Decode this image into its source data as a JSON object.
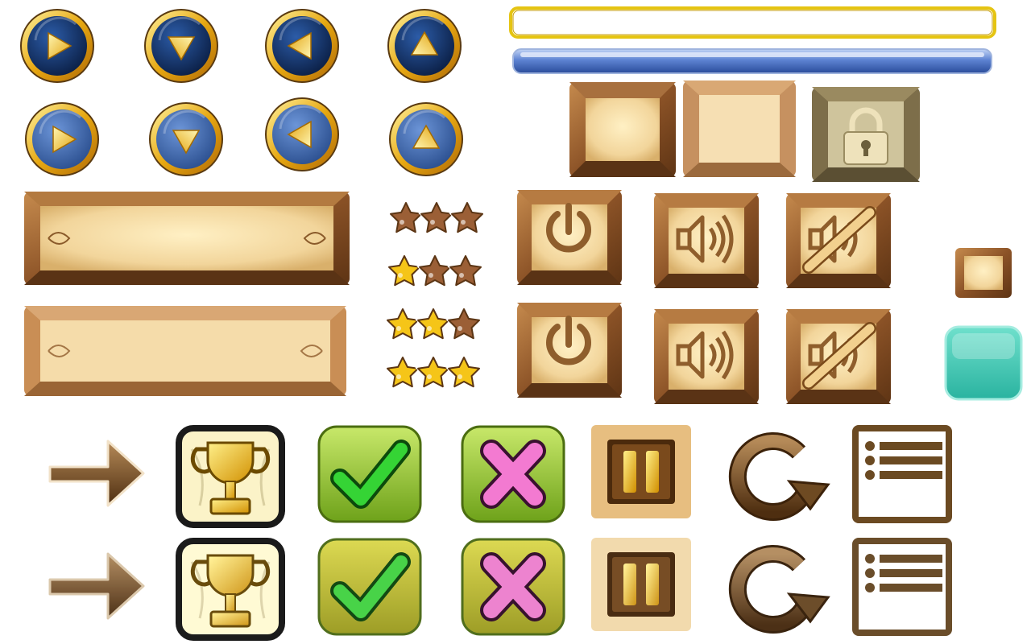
{
  "sprite_sheet": {
    "nav_arrows": [
      {
        "direction": "right",
        "state": "normal"
      },
      {
        "direction": "down",
        "state": "normal"
      },
      {
        "direction": "left",
        "state": "normal"
      },
      {
        "direction": "up",
        "state": "normal"
      },
      {
        "direction": "right",
        "state": "hover"
      },
      {
        "direction": "down",
        "state": "hover"
      },
      {
        "direction": "left",
        "state": "hover"
      },
      {
        "direction": "up",
        "state": "hover"
      }
    ],
    "star_ratings": [
      {
        "filled": 0,
        "total": 3
      },
      {
        "filled": 1,
        "total": 3
      },
      {
        "filled": 2,
        "total": 3
      },
      {
        "filled": 3,
        "total": 3
      }
    ],
    "wood_tiles": [
      "tile-normal",
      "tile-pressed",
      "lock-icon"
    ],
    "sound_buttons": [
      "power-icon",
      "speaker-icon",
      "mute-icon"
    ],
    "action_icons": [
      "arrow-right-icon",
      "trophy-icon",
      "checkmark-icon",
      "cross-icon",
      "pause-icon",
      "restart-icon",
      "menu-list-icon"
    ],
    "colors": {
      "navy": "#14356b",
      "gold": "#f1c40f",
      "wood_dark": "#8a5226",
      "wood_light": "#f3d8a0",
      "progress_blue": "#4a72c4",
      "teal": "#3cc4b0",
      "green": "#8cc63f",
      "check_green": "#35d435",
      "pink": "#f37ad1",
      "star_gold": "#f5c518",
      "star_brown": "#9b5f36"
    }
  }
}
